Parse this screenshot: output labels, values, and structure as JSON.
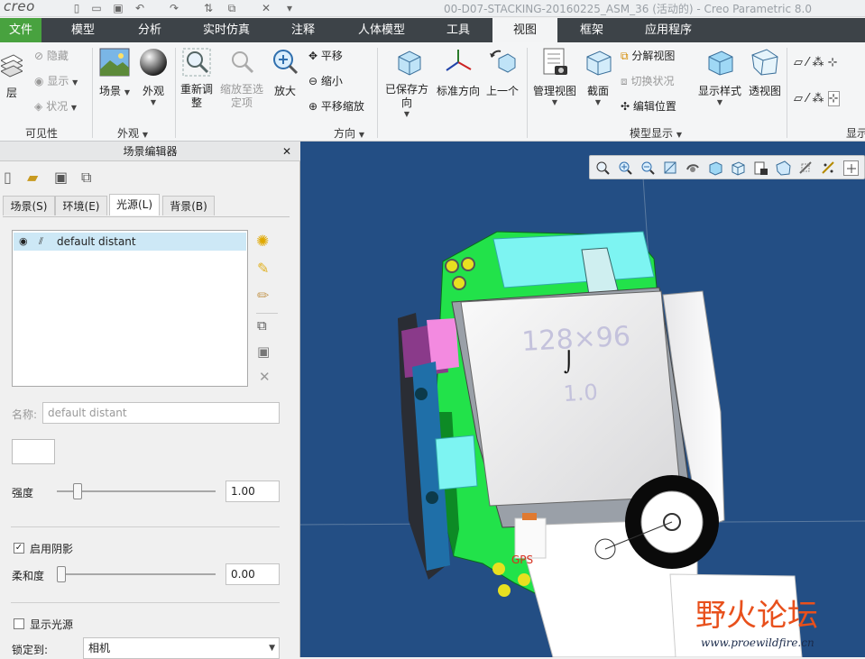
{
  "titlebar": {
    "logo": "creo",
    "window_title": "00-D07-STACKING-20160225_ASM_36 (活动的) - Creo Parametric 8.0"
  },
  "tabs": [
    "文件",
    "模型",
    "分析",
    "实时仿真",
    "注释",
    "人体模型",
    "工具",
    "视图",
    "框架",
    "应用程序"
  ],
  "ribbon": {
    "visibility": {
      "layer": "层",
      "hide": "隐藏",
      "show": "显示",
      "status": "状况",
      "group": "可见性"
    },
    "appearance": {
      "scene": "场景",
      "appearance": "外观",
      "group": "外观"
    },
    "orientation": {
      "refit": "重新调整",
      "zoom_to_selected": "缩放至选定项",
      "zoom_in": "放大",
      "pan": "平移",
      "zoom_out": "缩小",
      "pan_zoom": "平移缩放",
      "saved_orientations": "已保存方向",
      "standard_orientation": "标准方向",
      "previous": "上一个",
      "group": "方向"
    },
    "model_display": {
      "manage_views": "管理视图",
      "section": "截面",
      "exploded_view": "分解视图",
      "toggle_status": "切换状况",
      "edit_position": "编辑位置",
      "display_style": "显示样式",
      "perspective": "透视图",
      "group": "模型显示"
    },
    "show": {
      "group": "显示"
    }
  },
  "scene_editor": {
    "title": "场景编辑器",
    "tabs": [
      "场景(S)",
      "环境(E)",
      "光源(L)",
      "背景(B)"
    ],
    "active_tab": "光源(L)",
    "lights": [
      "default distant"
    ],
    "name_label": "名称:",
    "name_value": "default distant",
    "intensity_label": "强度",
    "intensity_value": "1.00",
    "intensity": 0.1,
    "enable_shadows_label": "启用阴影",
    "enable_shadows": true,
    "softness_label": "柔和度",
    "softness_value": "0.00",
    "softness": 0.0,
    "show_light_label": "显示光源",
    "show_light": false,
    "lock_to_label": "锁定到:",
    "lock_to_value": "相机"
  },
  "viewport": {
    "background": "#234e84",
    "lcd_text_1": "128×96",
    "lcd_text_2": "1.0",
    "gps_label": "GPS"
  },
  "watermark": {
    "title": "野火论坛",
    "url": "www.proewildfire.cn"
  }
}
